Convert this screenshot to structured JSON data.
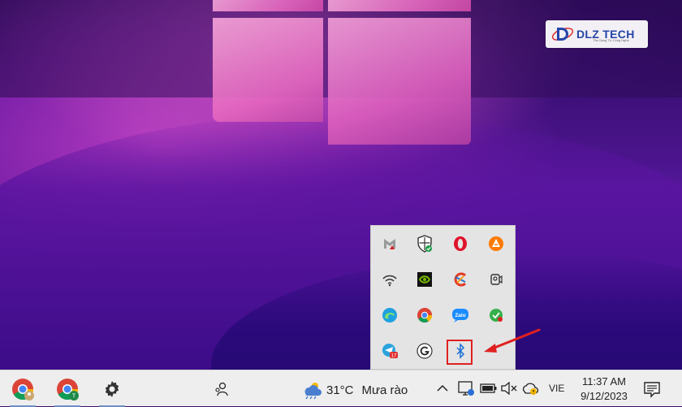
{
  "watermark": {
    "brand": "DLZ TECH",
    "tagline": "Tỏa Sáng Từ Công Nghệ"
  },
  "flyout": {
    "rows": [
      [
        "mcafee-icon",
        "windows-security-icon",
        "opera-icon",
        "avast-icon"
      ],
      [
        "wifi-icon",
        "nvidia-icon",
        "ccleaner-icon",
        "meet-now-icon"
      ],
      [
        "edge-icon",
        "chrome-icon",
        "zalo-icon",
        "check-badge-icon"
      ],
      [
        "telegram-icon",
        "grammarly-icon",
        "bluetooth-icon"
      ]
    ],
    "zalo_label": "Zalo",
    "telegram_badge": "17"
  },
  "taskbar": {
    "apps": [
      "chrome-icon",
      "chrome-icon",
      "settings-icon"
    ],
    "people_icon": "people-icon",
    "weather": {
      "temperature": "31°C",
      "condition": "Mưa rào"
    },
    "tray_icons": [
      "chevron-up-icon",
      "network-icon",
      "battery-icon",
      "volume-muted-icon",
      "onedrive-icon"
    ],
    "language": "VIE",
    "time": "11:37 AM",
    "date": "9/12/2023",
    "notification_icon": "action-center-icon"
  },
  "colors": {
    "highlight": "#e02020",
    "taskbar_bg": "#eeeeee",
    "flyout_bg": "#e4e4e4"
  }
}
